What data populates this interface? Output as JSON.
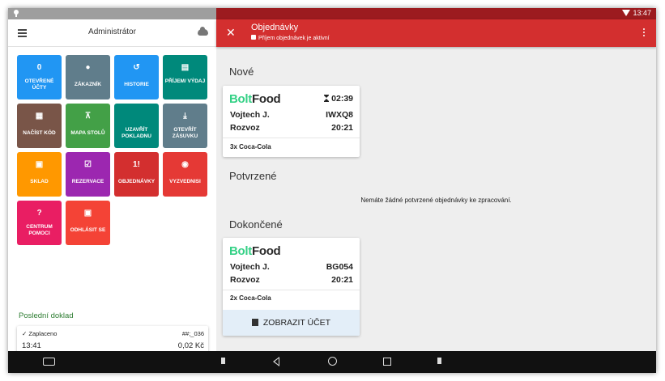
{
  "status_bar": {
    "time": "13:47"
  },
  "left_panel": {
    "title": "Administrátor",
    "tiles": [
      {
        "id": "open-accounts",
        "icon": "0",
        "label": "OTEVŘENÉ ÚČTY",
        "color": "#2196f3"
      },
      {
        "id": "customer",
        "icon": "person-icon",
        "label": "ZÁKAZNÍK",
        "color": "#607d8b"
      },
      {
        "id": "history",
        "icon": "history-icon",
        "label": "HISTORIE",
        "color": "#2196f3"
      },
      {
        "id": "income-expense",
        "icon": "coins-icon",
        "label": "PŘÍJEM/ VÝDAJ",
        "color": "#00897b"
      },
      {
        "id": "scan-code",
        "icon": "qr-icon",
        "label": "NAČÍST KÓD",
        "color": "#795548"
      },
      {
        "id": "table-map",
        "icon": "table-icon",
        "label": "MAPA STOLŮ",
        "color": "#43a047"
      },
      {
        "id": "close-register",
        "icon": "",
        "label": "UZAVŘÍT POKLADNU",
        "color": "#00897b"
      },
      {
        "id": "open-drawer",
        "icon": "download-icon",
        "label": "OTEVŘÍT ZÁSUVKU",
        "color": "#607d8b"
      },
      {
        "id": "stock",
        "icon": "forklift-icon",
        "label": "SKLAD",
        "color": "#ff9800"
      },
      {
        "id": "reservations",
        "icon": "calendar-icon",
        "label": "REZERVACE",
        "color": "#9c27b0"
      },
      {
        "id": "orders",
        "icon": "1!",
        "label": "OBJEDNÁVKY",
        "color": "#e53935"
      },
      {
        "id": "pickups",
        "icon": "bag-icon",
        "label": "VYZVEDNISI",
        "color": "#e53935"
      },
      {
        "id": "help-center",
        "icon": "help-icon",
        "label": "CENTRUM POMOCI",
        "color": "#e91e63"
      },
      {
        "id": "logout",
        "icon": "lock-icon",
        "label": "ODHLÁSIT SE",
        "color": "#f44336"
      }
    ],
    "last_doc": {
      "title": "Poslední doklad",
      "status": "Zaplaceno",
      "number": "##;_036",
      "time": "13:41",
      "amount": "0,02 Kč"
    }
  },
  "right_panel": {
    "title": "Objednávky",
    "subtitle": "Příjem objednávek je aktivní",
    "sections": {
      "new": "Nové",
      "confirmed": "Potvrzené",
      "done": "Dokončené"
    },
    "brand_a": "Bolt",
    "brand_b": "Food",
    "new_order": {
      "timer": "02:39",
      "customer": "Vojtech J.",
      "code": "IWXQ8",
      "type": "Rozvoz",
      "time": "20:21",
      "items": "3x  Coca-Cola"
    },
    "no_confirmed": "Nemáte žádné potvrzené objednávky ke zpracování.",
    "done_order": {
      "customer": "Vojtech J.",
      "code": "BG054",
      "type": "Rozvoz",
      "time": "20:21",
      "items": "2x  Coca-Cola",
      "button": "ZOBRAZIT ÚČET"
    }
  }
}
